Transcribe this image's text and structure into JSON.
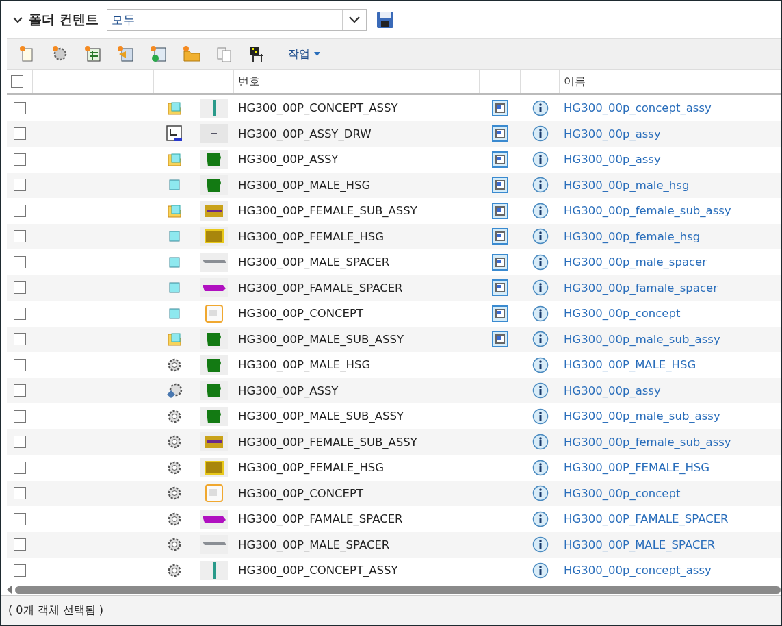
{
  "header": {
    "title": "폴더 컨텐트",
    "expanded": true,
    "filter": {
      "value": "모두"
    }
  },
  "toolbar": {
    "actions_menu": "작업"
  },
  "table": {
    "select_all": {
      "checked": false
    },
    "columns": [
      "번호",
      "이름"
    ],
    "rows": [
      {
        "checked": false,
        "icon": {
          "kind": "assembly"
        },
        "thumbnail": {
          "kind": "rod"
        },
        "viewable": true,
        "number": "HG300_00P_CONCEPT_ASSY",
        "name": "HG300_00p_concept_assy"
      },
      {
        "checked": false,
        "icon": {
          "kind": "drawing"
        },
        "thumbnail": {
          "kind": "tiny"
        },
        "viewable": true,
        "number": "HG300_00P_ASSY_DRW",
        "name": "HG300_00p_assy"
      },
      {
        "checked": false,
        "icon": {
          "kind": "assembly"
        },
        "thumbnail": {
          "kind": "green"
        },
        "viewable": true,
        "number": "HG300_00P_ASSY",
        "name": "HG300_00p_assy"
      },
      {
        "checked": false,
        "icon": {
          "kind": "part"
        },
        "thumbnail": {
          "kind": "green"
        },
        "viewable": true,
        "number": "HG300_00P_MALE_HSG",
        "name": "HG300_00p_male_hsg"
      },
      {
        "checked": false,
        "icon": {
          "kind": "assembly"
        },
        "thumbnail": {
          "kind": "striped"
        },
        "viewable": true,
        "number": "HG300_00P_FEMALE_SUB_ASSY",
        "name": "HG300_00p_female_sub_assy"
      },
      {
        "checked": false,
        "icon": {
          "kind": "part"
        },
        "thumbnail": {
          "kind": "block"
        },
        "viewable": true,
        "number": "HG300_00P_FEMALE_HSG",
        "name": "HG300_00p_female_hsg"
      },
      {
        "checked": false,
        "icon": {
          "kind": "part"
        },
        "thumbnail": {
          "kind": "flat"
        },
        "viewable": true,
        "number": "HG300_00P_MALE_SPACER",
        "name": "HG300_00p_male_spacer"
      },
      {
        "checked": false,
        "icon": {
          "kind": "part"
        },
        "thumbnail": {
          "kind": "long"
        },
        "viewable": true,
        "number": "HG300_00P_FAMALE_SPACER",
        "name": "HG300_00p_famale_spacer"
      },
      {
        "checked": false,
        "icon": {
          "kind": "part"
        },
        "thumbnail": {
          "kind": "doc"
        },
        "viewable": true,
        "number": "HG300_00P_CONCEPT",
        "name": "HG300_00p_concept"
      },
      {
        "checked": false,
        "icon": {
          "kind": "assembly"
        },
        "thumbnail": {
          "kind": "green"
        },
        "viewable": true,
        "number": "HG300_00P_MALE_SUB_ASSY",
        "name": "HG300_00p_male_sub_assy"
      },
      {
        "checked": false,
        "icon": {
          "kind": "gear"
        },
        "thumbnail": {
          "kind": "green"
        },
        "viewable": false,
        "number": "HG300_00P_MALE_HSG",
        "name": "HG300_00P_MALE_HSG"
      },
      {
        "checked": false,
        "icon": {
          "kind": "linked"
        },
        "thumbnail": {
          "kind": "green"
        },
        "viewable": false,
        "number": "HG300_00P_ASSY",
        "name": "HG300_00p_assy"
      },
      {
        "checked": false,
        "icon": {
          "kind": "gear"
        },
        "thumbnail": {
          "kind": "green"
        },
        "viewable": false,
        "number": "HG300_00P_MALE_SUB_ASSY",
        "name": "HG300_00p_male_sub_assy"
      },
      {
        "checked": false,
        "icon": {
          "kind": "gear"
        },
        "thumbnail": {
          "kind": "striped"
        },
        "viewable": false,
        "number": "HG300_00P_FEMALE_SUB_ASSY",
        "name": "HG300_00p_female_sub_assy"
      },
      {
        "checked": false,
        "icon": {
          "kind": "gear"
        },
        "thumbnail": {
          "kind": "block"
        },
        "viewable": false,
        "number": "HG300_00P_FEMALE_HSG",
        "name": "HG300_00P_FEMALE_HSG"
      },
      {
        "checked": false,
        "icon": {
          "kind": "gear"
        },
        "thumbnail": {
          "kind": "doc"
        },
        "viewable": false,
        "number": "HG300_00P_CONCEPT",
        "name": "HG300_00p_concept"
      },
      {
        "checked": false,
        "icon": {
          "kind": "gear"
        },
        "thumbnail": {
          "kind": "long"
        },
        "viewable": false,
        "number": "HG300_00P_FAMALE_SPACER",
        "name": "HG300_00P_FAMALE_SPACER"
      },
      {
        "checked": false,
        "icon": {
          "kind": "gear"
        },
        "thumbnail": {
          "kind": "flat"
        },
        "viewable": false,
        "number": "HG300_00P_MALE_SPACER",
        "name": "HG300_00P_MALE_SPACER"
      },
      {
        "checked": false,
        "icon": {
          "kind": "gear"
        },
        "thumbnail": {
          "kind": "rod"
        },
        "viewable": false,
        "number": "HG300_00P_CONCEPT_ASSY",
        "name": "HG300_00p_concept_assy"
      }
    ]
  },
  "status_bar": "( 0개 객체 선택됨 )"
}
